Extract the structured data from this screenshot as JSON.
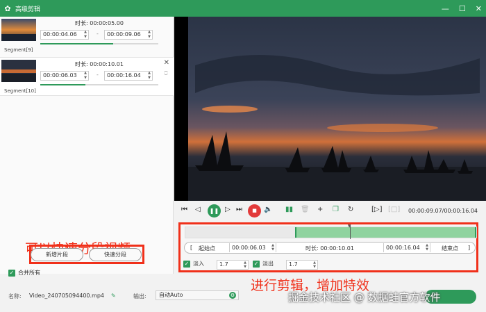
{
  "window": {
    "title": "高级剪辑",
    "logo_icon": "rabbit-logo-icon",
    "accent": "#2e9a5a"
  },
  "segments": [
    {
      "name": "Segment[9]",
      "duration_label": "时长:",
      "duration": "00:00:05.00",
      "start": "00:00:04.06",
      "end": "00:00:09.06",
      "dash": "-",
      "progress": 0.62
    },
    {
      "name": "Segment[10]",
      "duration_label": "时长:",
      "duration": "00:00:10.01",
      "start": "00:00:06.03",
      "end": "00:00:16.04",
      "dash": "-",
      "progress": 0.38
    }
  ],
  "left_buttons": {
    "new_segment": "新增片段",
    "quick_split": "快速分段"
  },
  "merge_all": {
    "label": "合并所有",
    "checked": true
  },
  "annotations": {
    "left": "可以快速分段视频",
    "right": "进行剪辑，增加特效",
    "color": "#f0301a"
  },
  "player": {
    "time_readout": "00:00:09.07/00:00:16.04"
  },
  "trim": {
    "start_label": "起始点",
    "start_value": "00:00:06.03",
    "duration_label": "时长:",
    "duration_value": "00:00:10.01",
    "end_value": "00:00:16.04",
    "end_label": "结束点",
    "bracket_left": "[",
    "bracket_right": "]"
  },
  "fade": {
    "in_label": "淡入",
    "in_value": "1.7",
    "out_label": "淡出",
    "out_value": "1.7"
  },
  "bottom": {
    "name_label": "名称:",
    "file_name": "Video_240705094400.mp4",
    "output_label": "输出:",
    "output_value": "自动Auto",
    "watermark": "掘金技术社区 @ 数据蛙官方软件"
  }
}
